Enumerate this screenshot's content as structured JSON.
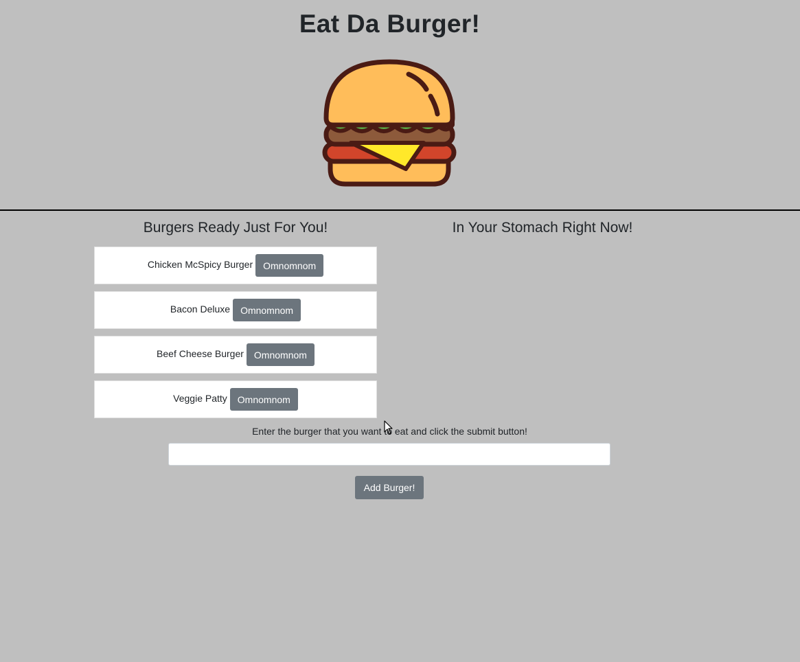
{
  "header": {
    "title": "Eat Da Burger!"
  },
  "logo": {
    "icon": "burger-icon",
    "colors": {
      "outline": "#4a1b14",
      "bun": "#ffbd5a",
      "lettuce": "#5cb84a",
      "patty": "#8d5a3b",
      "tomato": "#d2452b",
      "cheese": "#ffe82a"
    }
  },
  "columns": {
    "ready_title": "Burgers Ready Just For You!",
    "eaten_title": "In Your Stomach Right Now!"
  },
  "burgers": [
    {
      "name": "Chicken McSpicy Burger",
      "button": "Omnomnom"
    },
    {
      "name": "Bacon Deluxe",
      "button": "Omnomnom"
    },
    {
      "name": "Beef Cheese Burger",
      "button": "Omnomnom"
    },
    {
      "name": "Veggie Patty",
      "button": "Omnomnom"
    }
  ],
  "eaten": [],
  "form": {
    "prompt": "Enter the burger that you want to eat and click the submit button!",
    "input_value": "",
    "input_placeholder": "",
    "submit_label": "Add Burger!"
  },
  "colors": {
    "background": "#bfbfbf",
    "button": "#6c757d",
    "card": "#ffffff"
  }
}
